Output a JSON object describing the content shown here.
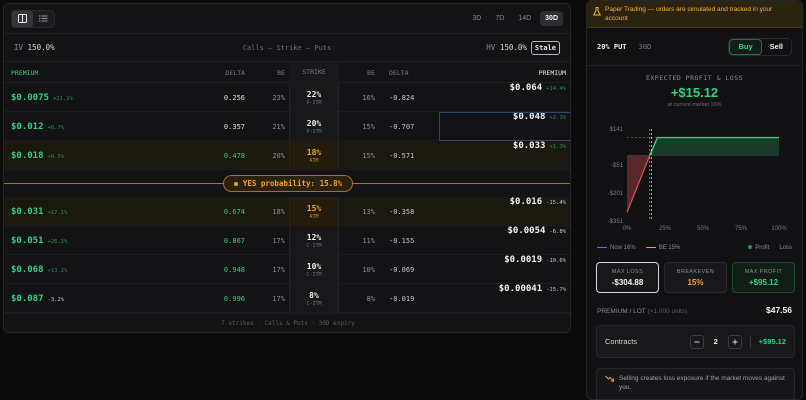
{
  "chain": {
    "view_buttons": [
      {
        "icon": "grid-view-icon",
        "active": true
      },
      {
        "icon": "list-view-icon",
        "active": false
      }
    ],
    "expiries": [
      {
        "label": "3D"
      },
      {
        "label": "7D"
      },
      {
        "label": "14D"
      },
      {
        "label": "30D",
        "active": true
      }
    ],
    "iv_label": "IV",
    "iv_value": "150.0%",
    "center_label": "Calls — Strike — Puts",
    "hv_label": "HV",
    "hv_value": "150.0%",
    "stale_label": "Stale",
    "headers": {
      "premium_call": "PREMIUM",
      "delta_call": "DELTA",
      "be_call": "BE",
      "strike": "STRIKE",
      "be_put": "BE",
      "delta_put": "DELTA",
      "premium_put": "PREMIUM"
    },
    "rows": [
      {
        "call_price": "$0.0075",
        "call_change": "+21.1%",
        "call_delta": "0.256",
        "call_be": "23%",
        "strike": "22%",
        "tag": "P-ITM",
        "put_be": "16%",
        "put_delta": "-0.824",
        "put_price": "$0.064",
        "put_change": "+14.4%"
      },
      {
        "call_price": "$0.012",
        "call_change": "+6.7%",
        "call_delta": "0.357",
        "call_be": "21%",
        "strike": "20%",
        "tag": "P-ITM",
        "put_be": "15%",
        "put_delta": "-0.707",
        "put_price": "$0.048",
        "put_change": "+2.1%"
      },
      {
        "call_price": "$0.018",
        "call_change": "+8.5%",
        "call_delta": "0.478",
        "call_be": "20%",
        "strike": "18%",
        "tag": "ATM",
        "put_be": "15%",
        "put_delta": "-0.571",
        "put_price": "$0.033",
        "put_change": "+1.3%"
      },
      {
        "call_price": "$0.031",
        "call_change": "+17.1%",
        "call_delta": "0.674",
        "call_be": "18%",
        "strike": "15%",
        "tag": "ATM",
        "put_be": "13%",
        "put_delta": "-0.358",
        "put_price": "$0.016",
        "put_change": "-15.4%"
      },
      {
        "call_price": "$0.051",
        "call_change": "+26.1%",
        "call_delta": "0.867",
        "call_be": "17%",
        "strike": "12%",
        "tag": "C-ITM",
        "put_be": "11%",
        "put_delta": "-0.155",
        "put_price": "$0.0054",
        "put_change": "-6.8%"
      },
      {
        "call_price": "$0.068",
        "call_change": "+13.2%",
        "call_delta": "0.948",
        "call_be": "17%",
        "strike": "10%",
        "tag": "C-ITM",
        "put_be": "10%",
        "put_delta": "-0.069",
        "put_price": "$0.0019",
        "put_change": "-10.6%"
      },
      {
        "call_price": "$0.087",
        "call_change": "-3.2%",
        "call_delta": "0.996",
        "call_be": "17%",
        "strike": "8%",
        "tag": "C-ITM",
        "put_be": "8%",
        "put_delta": "-0.019",
        "put_price": "$0.00041",
        "put_change": "-15.7%"
      }
    ],
    "probability": "YES probability: 15.8%",
    "footer": "7 strikes · Calls & Puts · 30D expiry"
  },
  "trade": {
    "banner": "Paper Trading — orders are simulated and tracked in your account",
    "selection": "20% PUT",
    "expiry": "30D",
    "buy_label": "Buy",
    "sell_label": "Sell",
    "pl_title": "EXPECTED PROFIT & LOSS",
    "pl_value": "+$15.12",
    "pl_sub": "at current market 16%",
    "chart_y_labels": [
      "$141",
      "-$51",
      "-$201",
      "-$351"
    ],
    "chart_x_labels": [
      "0%",
      "25%",
      "50%",
      "75%",
      "100%"
    ],
    "legend_now": "Now 16%",
    "legend_be": "BE 15%",
    "legend_profit": "Profit",
    "legend_loss": "Loss",
    "max_loss_label": "MAX LOSS",
    "max_loss": "-$304.88",
    "breakeven_label": "BREAKEVEN",
    "breakeven": "15%",
    "max_profit_label": "MAX PROFIT",
    "max_profit": "+$95.12",
    "lot_label": "PREMIUM / LOT",
    "lot_units": "(×1,000 units)",
    "lot_value": "$47.56",
    "contracts_label": "Contracts",
    "contracts_qty": "2",
    "contracts_total": "+$95.12",
    "warning": "Selling creates loss exposure if the market moves against you."
  },
  "colors": {
    "green": "#35d07f",
    "amber": "#f5a524",
    "red": "#e05252",
    "blue": "#3b82f6"
  },
  "chart_data": {
    "type": "area",
    "xlabel": "",
    "ylabel": "",
    "xlim": [
      0,
      100
    ],
    "ylim": [
      -351,
      141
    ],
    "x": [
      0,
      15,
      20,
      100
    ],
    "values": [
      -304.88,
      0,
      95.12,
      95.12
    ],
    "breakeven": 15,
    "now": 16
  }
}
